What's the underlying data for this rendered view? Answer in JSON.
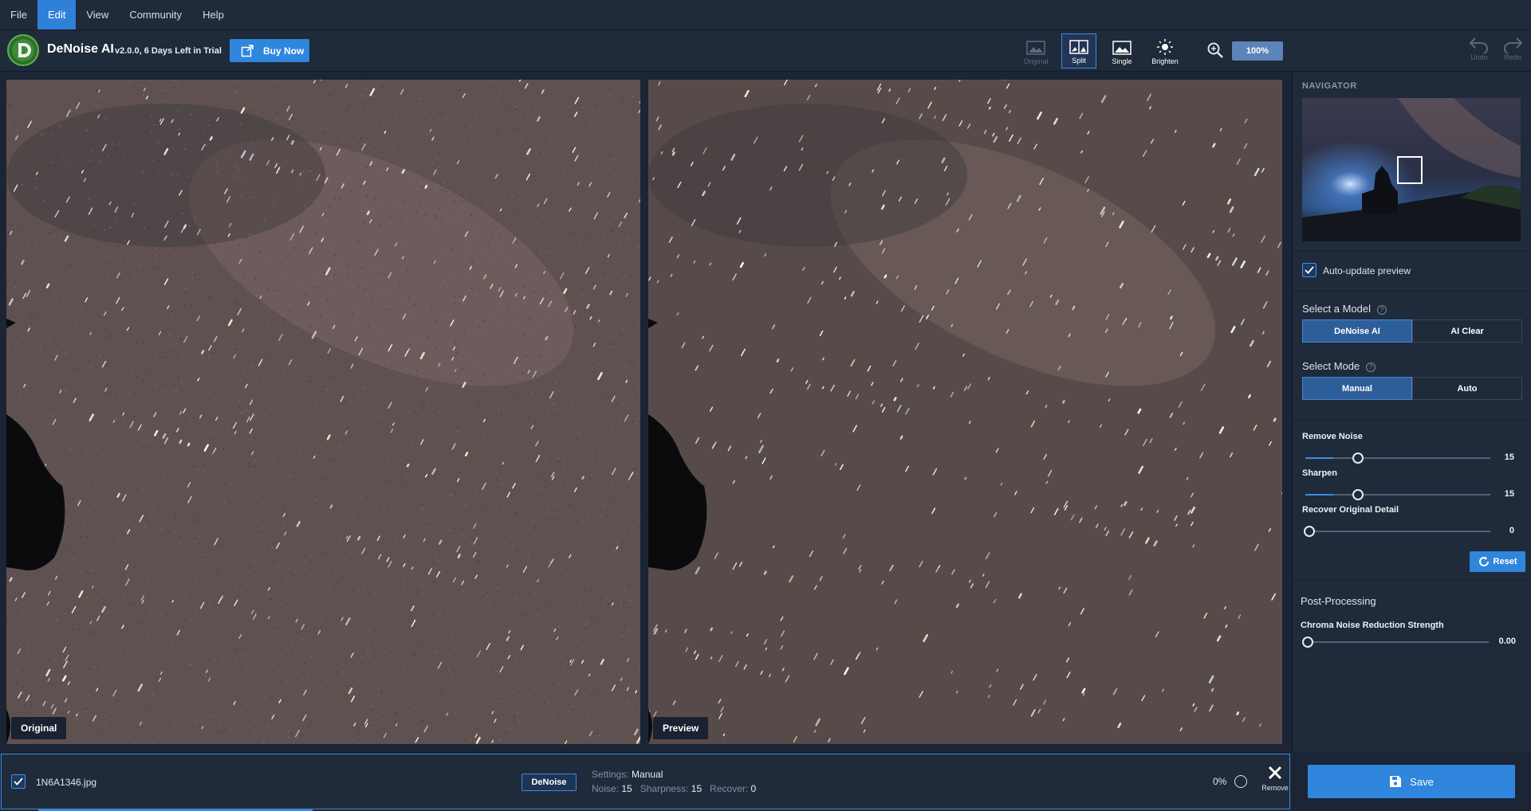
{
  "menu": [
    "File",
    "Edit",
    "View",
    "Community",
    "Help"
  ],
  "menu_active": "Edit",
  "app": {
    "title": "DeNoise AI",
    "version": "v2.0.0, 6 Days Left in Trial",
    "buy_label": "Buy Now"
  },
  "view_modes": {
    "original": "Original",
    "split": "Split",
    "single": "Single",
    "brighten": "Brighten"
  },
  "zoom": "100%",
  "history": {
    "undo": "Undo",
    "redo": "Redo"
  },
  "panes": {
    "left_label": "Original",
    "right_label": "Preview"
  },
  "sidebar": {
    "navigator_title": "NAVIGATOR",
    "auto_update": "Auto-update preview",
    "model_title": "Select a Model",
    "models": [
      "DeNoise AI",
      "AI Clear"
    ],
    "mode_title": "Select Mode",
    "modes": [
      "Manual",
      "Auto"
    ],
    "sliders": [
      {
        "label": "Remove Noise",
        "value": 15,
        "max": 100
      },
      {
        "label": "Sharpen",
        "value": 15,
        "max": 100
      },
      {
        "label": "Recover Original Detail",
        "value": 0,
        "max": 100
      }
    ],
    "reset_label": "Reset",
    "post_title": "Post-Processing",
    "chroma_label": "Chroma Noise Reduction Strength",
    "chroma_value": "0.00"
  },
  "file": {
    "name": "1N6A1346.jpg",
    "tag": "DeNoise",
    "settings_label": "Settings:",
    "settings_value": "Manual",
    "noise_label": "Noise:",
    "noise_value": "15",
    "sharpness_label": "Sharpness:",
    "sharpness_value": "15",
    "recover_label": "Recover:",
    "recover_value": "0",
    "progress": "0%",
    "remove_label": "Remove"
  },
  "save_label": "Save",
  "colors": {
    "accent": "#2f86dc",
    "panel": "#1f2a3b",
    "background": "#1b2535"
  }
}
